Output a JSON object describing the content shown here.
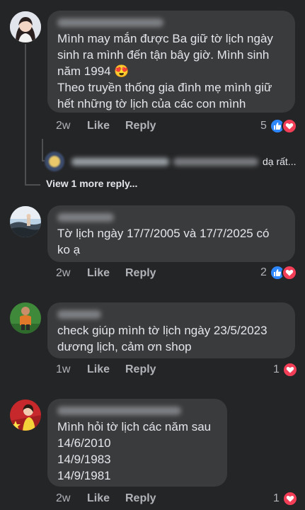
{
  "comments": [
    {
      "text": "Mình may mắn được Ba giữ tờ lịch ngày\nsinh ra mình đến tận bây giờ. Mình sinh\nnăm 1994 😍\nTheo truyền thống gia đình mẹ mình giữ\nhết những tờ lịch của các con mình",
      "time": "2w",
      "like_label": "Like",
      "reply_label": "Reply",
      "reaction_count": "5",
      "reactions": [
        "like-icon",
        "love-icon"
      ]
    },
    {
      "text": "Tờ lịch ngày 17/7/2005 và 17/7/2025 có\nko ạ",
      "time": "2w",
      "like_label": "Like",
      "reply_label": "Reply",
      "reaction_count": "2",
      "reactions": [
        "like-icon",
        "love-icon"
      ]
    },
    {
      "text": "check giúp mình tờ lịch ngày 23/5/2023\ndương lịch, cảm ơn shop",
      "time": "1w",
      "like_label": "Like",
      "reply_label": "Reply",
      "reaction_count": "1",
      "reactions": [
        "love-icon"
      ]
    },
    {
      "text": "Mình hỏi tờ lịch các năm sau\n14/6/2010\n14/9/1983\n14/9/1981",
      "time": "2w",
      "like_label": "Like",
      "reply_label": "Reply",
      "reaction_count": "1",
      "reactions": [
        "love-icon"
      ]
    }
  ],
  "reply_preview": {
    "text": "dạ rất..."
  },
  "view_more_label": "View 1 more reply...",
  "colors": {
    "background": "#242526",
    "bubble": "#3a3b3c",
    "text": "#e4e6eb",
    "meta": "#b0b3b8",
    "like": "#2d88ff",
    "love": "#f33e58"
  }
}
